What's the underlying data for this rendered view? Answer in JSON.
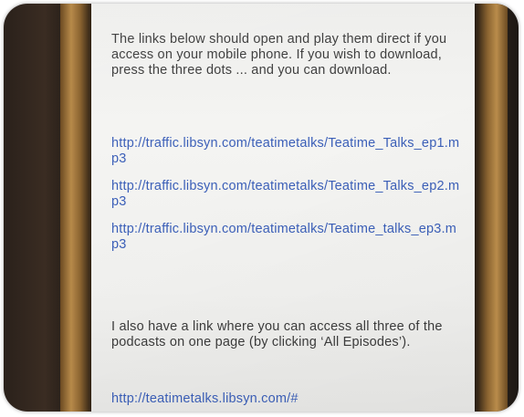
{
  "message": {
    "intro": "The links below should open and play them direct if you access on your mobile phone.  If you wish to download, press the three dots ... and you can download.",
    "links": [
      "http://traffic.libsyn.com/teatimetalks/Teatime_Talks_ep1.mp3",
      "http://traffic.libsyn.com/teatimetalks/Teatime_Talks_ep2.mp3",
      "http://traffic.libsyn.com/teatimetalks/Teatime_talks_ep3.mp3"
    ],
    "outro": "I also have a link where you can access all three of the podcasts on one page (by clicking ‘All Episodes’).",
    "all_episodes_link": "http://teatimetalks.libsyn.com/#"
  },
  "colors": {
    "link": "#3b5fb8",
    "body_text": "#3c3c3c",
    "screen_background": "#f1f1ef",
    "phone_frame": "#b78a4a"
  }
}
